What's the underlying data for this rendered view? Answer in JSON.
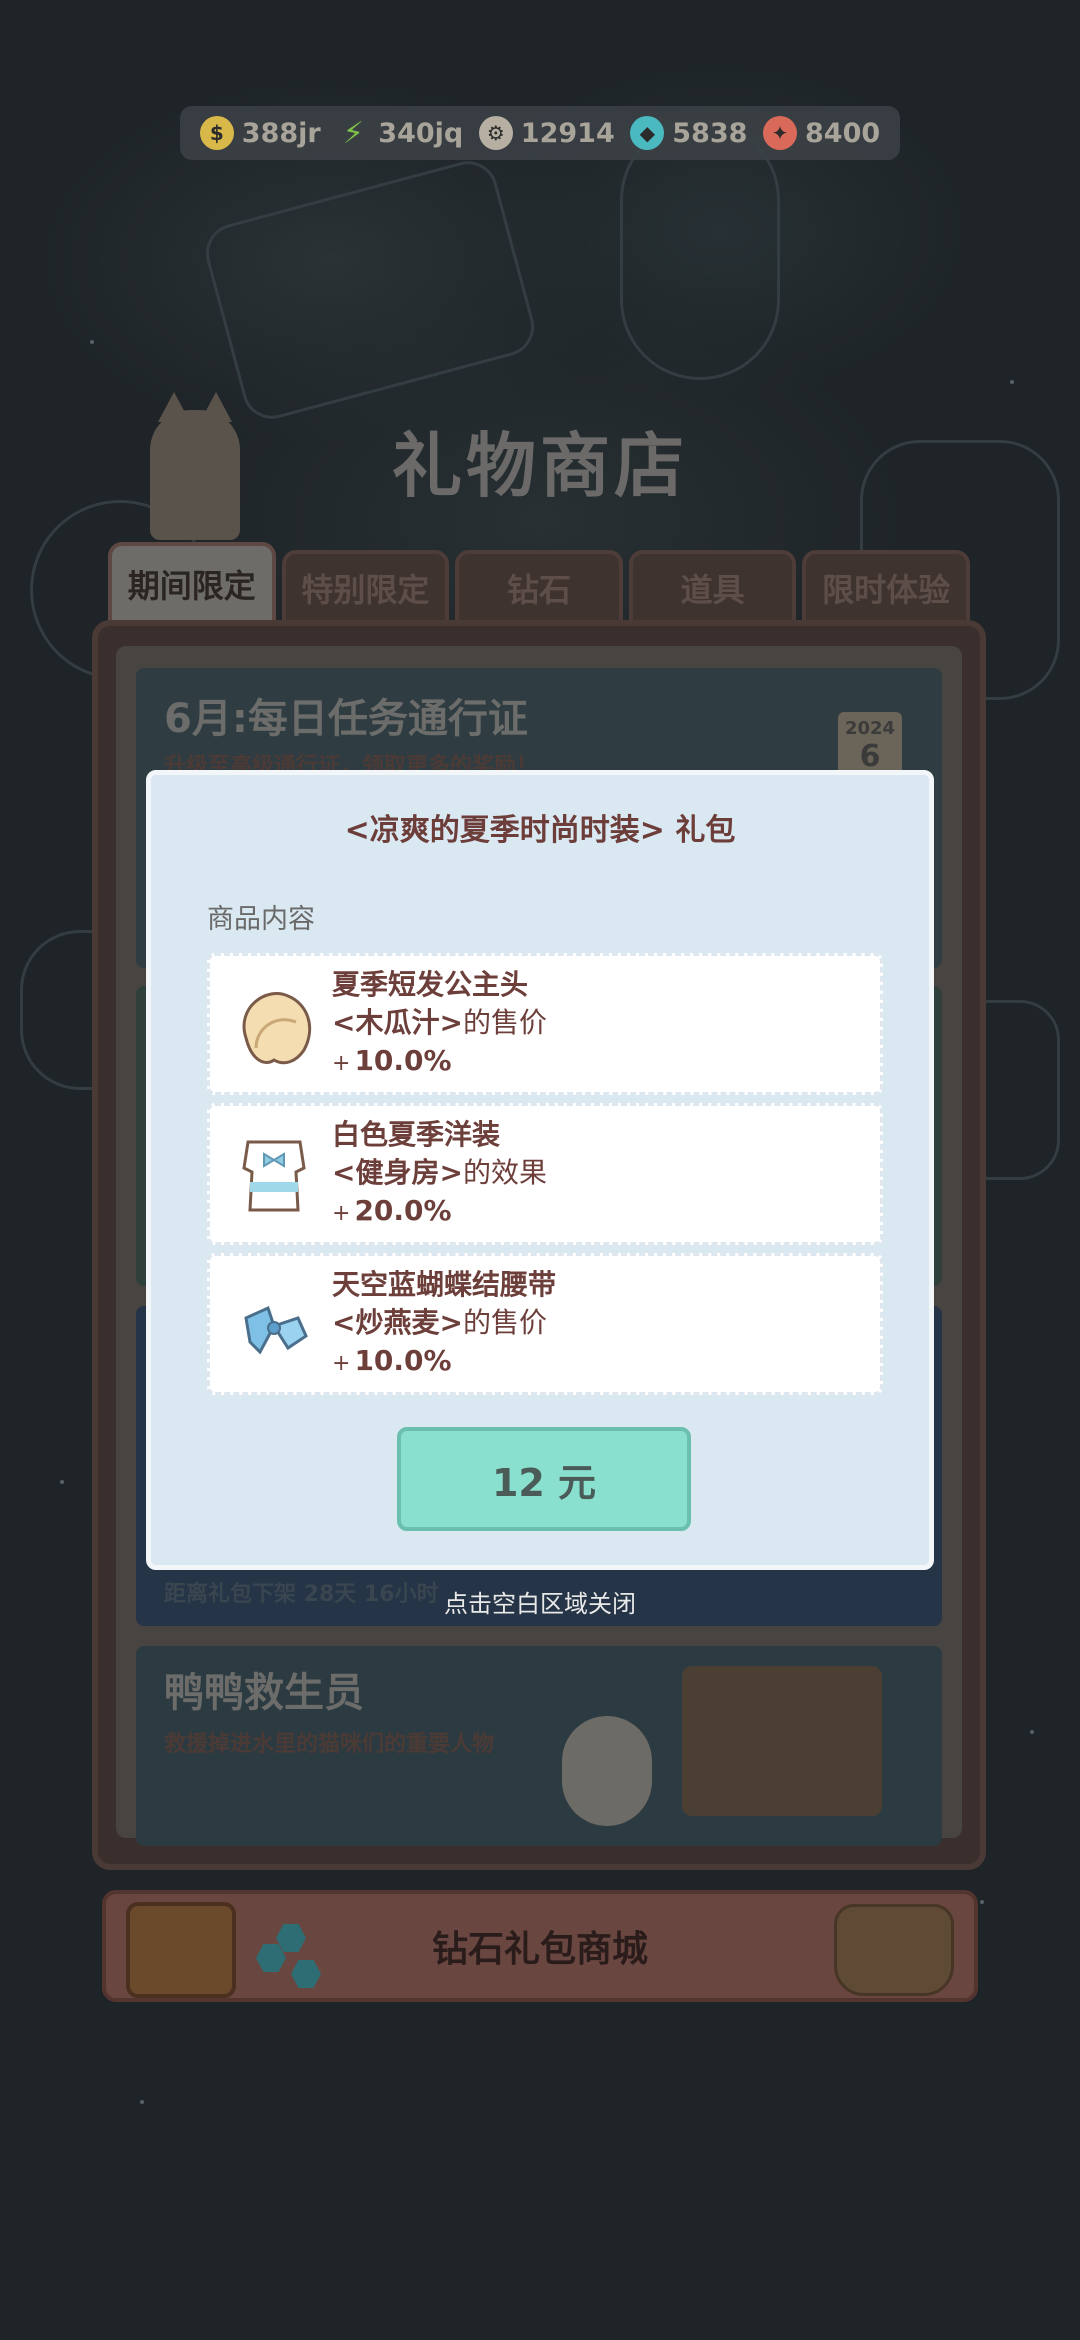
{
  "currencies": [
    {
      "icon": "coin-icon",
      "value": "388jr",
      "color": "#d9b84a"
    },
    {
      "icon": "lightning-icon",
      "value": "340jq",
      "color": "#7cc04a"
    },
    {
      "icon": "gear-coin-icon",
      "value": "12914",
      "color": "#b7b0a2"
    },
    {
      "icon": "diamond-icon",
      "value": "5838",
      "color": "#4ab9c0"
    },
    {
      "icon": "ticket-icon",
      "value": "8400",
      "color": "#d96a5a"
    }
  ],
  "shop": {
    "title": "礼物商店",
    "tabs": [
      "期间限定",
      "特别限定",
      "钻石",
      "道具",
      "限时体验"
    ],
    "active_tab": "期间限定"
  },
  "cards": {
    "pass": {
      "title": "6月:每日任务通行证",
      "subtitle": "升级至高级通行证，领取更多的奖励！",
      "badge_year": "2024",
      "badge_month": "6"
    },
    "hidden_caption": "距离礼包下架 28天 16小时",
    "lifeguard": {
      "title": "鸭鸭救生员",
      "subtitle": "救援掉进水里的猫咪们的重要人物"
    }
  },
  "diamond_banner": {
    "label": "钻石礼包商城"
  },
  "modal": {
    "title": "<凉爽的夏季时尚时装> 礼包",
    "section_label": "商品内容",
    "items": [
      {
        "icon": "short-hair-wig-icon",
        "name": "夏季短发公主头",
        "target": "<木瓜汁>",
        "effect": "的售价",
        "plus": "+",
        "percent": "10.0%"
      },
      {
        "icon": "white-dress-icon",
        "name": "白色夏季洋装",
        "target": "<健身房>",
        "effect": "的效果",
        "plus": "+",
        "percent": "20.0%"
      },
      {
        "icon": "blue-bow-belt-icon",
        "name": "天空蓝蝴蝶结腰带",
        "target": "<炒燕麦>",
        "effect": "的售价",
        "plus": "+",
        "percent": "10.0%"
      }
    ],
    "price_label": "12 元",
    "close_hint": "点击空白区域关闭"
  }
}
